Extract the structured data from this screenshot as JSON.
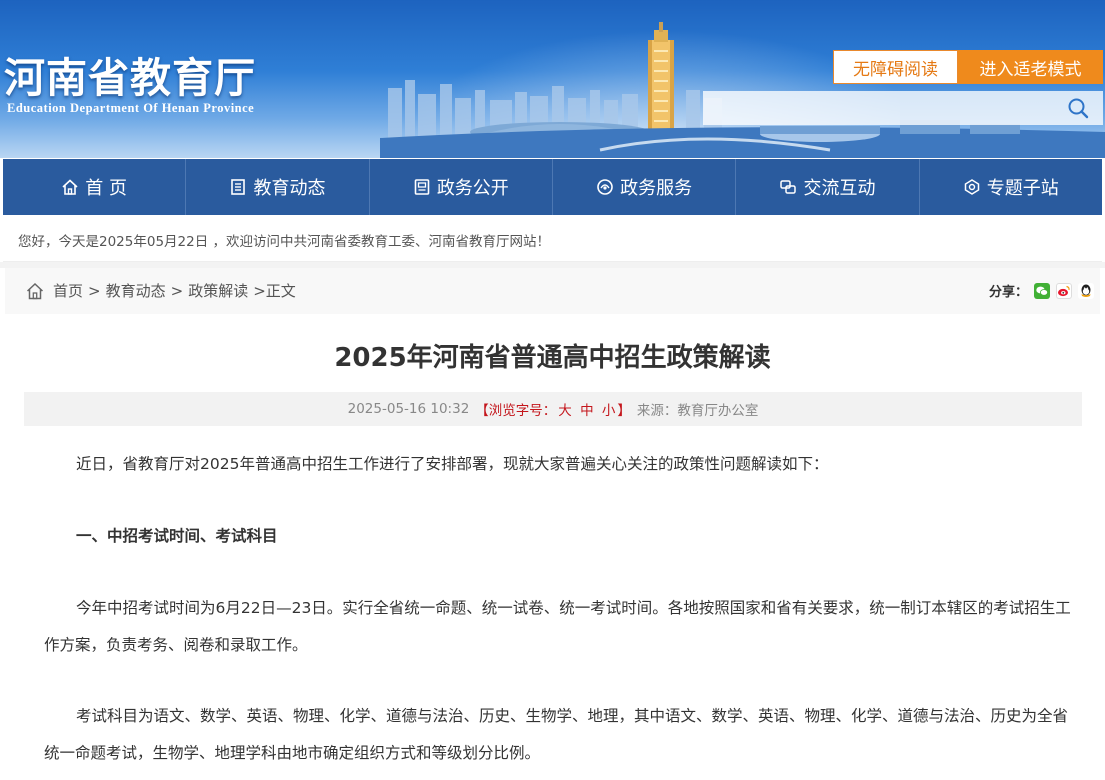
{
  "header": {
    "site_title": "河南省教育厅",
    "site_subtitle": "Education Department Of Henan Province",
    "accessibility_label": "无障碍阅读",
    "elder_mode_label": "进入适老模式",
    "search_placeholder": "",
    "accent_color": "#ef8a1c"
  },
  "nav": {
    "items": [
      {
        "label": "首 页",
        "icon": "home-icon"
      },
      {
        "label": "教育动态",
        "icon": "news-icon"
      },
      {
        "label": "政务公开",
        "icon": "document-icon"
      },
      {
        "label": "政务服务",
        "icon": "service-icon"
      },
      {
        "label": "交流互动",
        "icon": "interaction-icon"
      },
      {
        "label": "专题子站",
        "icon": "topic-icon"
      }
    ],
    "background": "#2a5b9e"
  },
  "welcome": "您好，今天是2025年05月22日 ，欢迎访问中共河南省委教育工委、河南省教育厅网站！",
  "breadcrumb": {
    "items": [
      "首页",
      "教育动态",
      "政策解读"
    ],
    "current": ">正文",
    "separator": ">"
  },
  "share": {
    "label": "分享：",
    "targets": [
      "wechat-icon",
      "weibo-icon",
      "qq-icon"
    ]
  },
  "article": {
    "title": "2025年河南省普通高中招生政策解读",
    "date": "2025-05-16 10:32",
    "font_size_label_open": "【浏览字号：",
    "font_size_large": "大",
    "font_size_medium": "中",
    "font_size_small": "小",
    "font_size_label_close": "】",
    "source": "来源：教育厅办公室",
    "paragraphs": [
      "近日，省教育厅对2025年普通高中招生工作进行了安排部署，现就大家普遍关心关注的政策性问题解读如下：",
      "一、中招考试时间、考试科目",
      "今年中招考试时间为6月22日—23日。实行全省统一命题、统一试卷、统一考试时间。各地按照国家和省有关要求，统一制订本辖区的考试招生工作方案，负责考务、阅卷和录取工作。",
      "考试科目为语文、数学、英语、物理、化学、道德与法治、历史、生物学、地理，其中语文、数学、英语、物理、化学、道德与法治、历史为全省统一命题考试，生物学、地理学科由地市确定组织方式和等级划分比例。"
    ]
  }
}
